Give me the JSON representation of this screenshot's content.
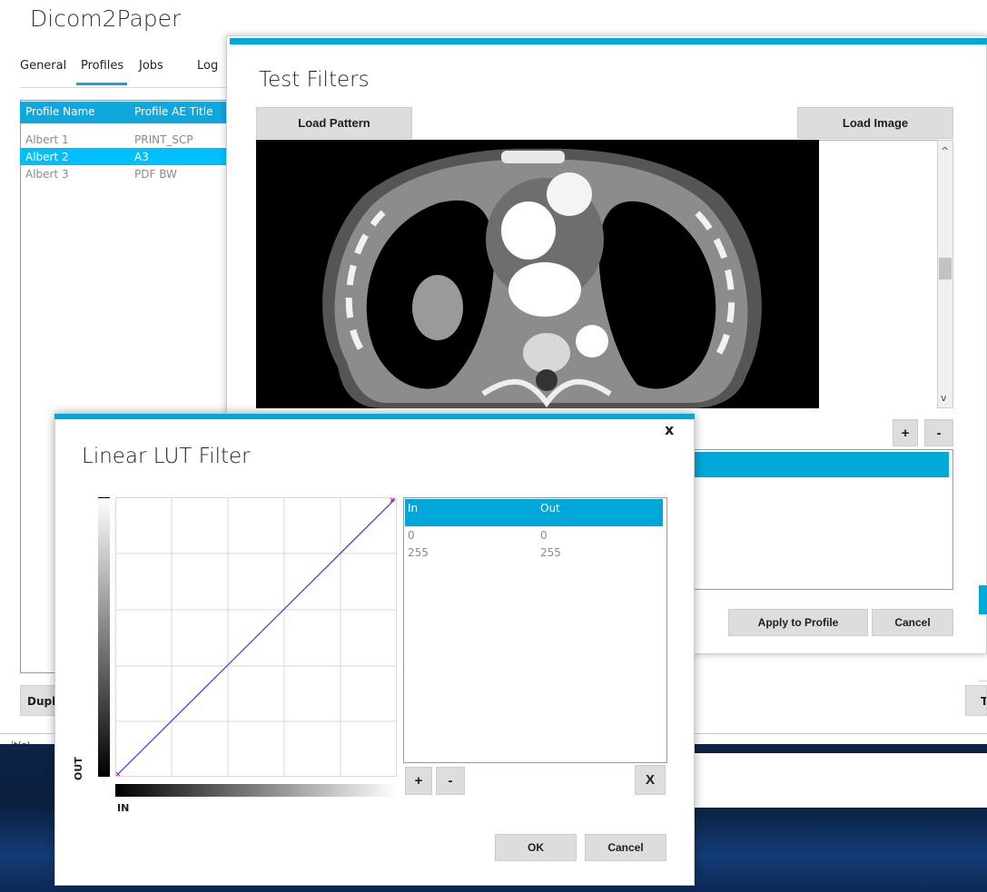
{
  "app": {
    "title": "Dicom2Paper",
    "tabs": [
      "General",
      "Profiles",
      "Jobs",
      "Log"
    ],
    "active_tab": "Profiles",
    "profiles_table": {
      "columns": [
        "Profile Name",
        "Profile AE Title"
      ],
      "rows": [
        {
          "name": "Albert 1",
          "ae": "PRINT_SCP",
          "selected": false
        },
        {
          "name": "Albert 2",
          "ae": "A3",
          "selected": true
        },
        {
          "name": "Albert 3",
          "ae": "PDF BW",
          "selected": false
        }
      ]
    },
    "duplicate_label": "Dupl",
    "right_button_label": "T",
    "status_text": "it(s)",
    "accent_color": "#00A8DA"
  },
  "test_filters": {
    "title": "Test Filters",
    "load_pattern_label": "Load Pattern",
    "load_image_label": "Load Image",
    "add_label": "+",
    "remove_label": "-",
    "apply_label": "Apply to Profile",
    "cancel_label": "Cancel"
  },
  "lut_dialog": {
    "title": "Linear LUT Filter",
    "close_label": "x",
    "out_axis_label": "OUT",
    "in_axis_label": "IN",
    "table": {
      "columns": [
        "In",
        "Out"
      ],
      "rows": [
        [
          "0",
          "0"
        ],
        [
          "255",
          "255"
        ]
      ]
    },
    "add_label": "+",
    "remove_label": "-",
    "clear_label": "X",
    "ok_label": "OK",
    "cancel_label": "Cancel",
    "curve": {
      "points": [
        [
          0,
          0
        ],
        [
          255,
          255
        ]
      ],
      "color": "#3333FF",
      "marker_color": "#B0307A"
    }
  }
}
